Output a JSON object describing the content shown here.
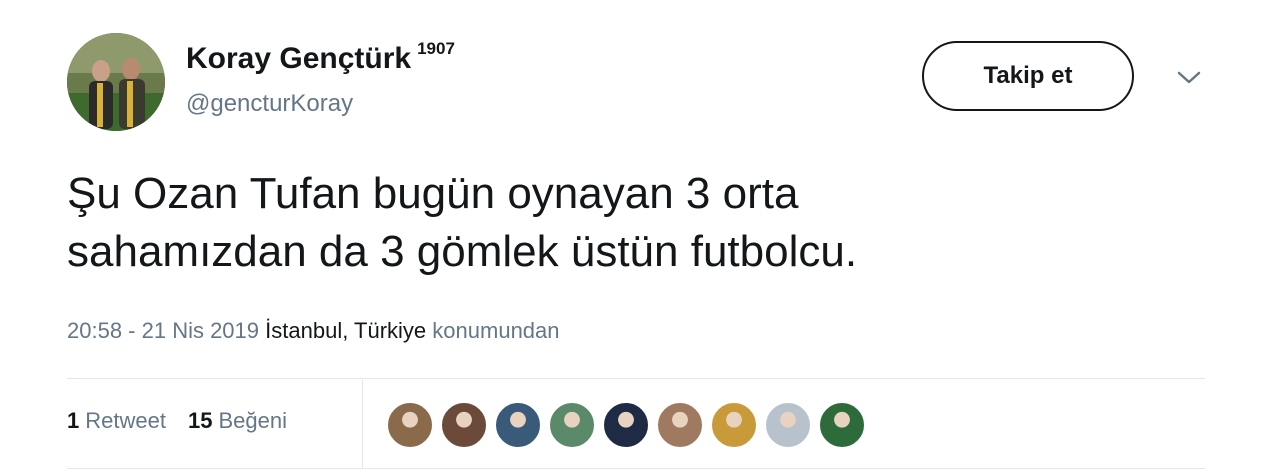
{
  "user": {
    "display_name": "Koray Gençtürk",
    "superscript": "1907",
    "handle": "@gencturKoray"
  },
  "actions": {
    "follow_label": "Takip et",
    "menu_icon": "chevron-down-icon"
  },
  "tweet": {
    "text_line1": "Şu Ozan Tufan bugün oynayan 3 orta",
    "text_line2": "sahamızdan da 3 gömlek üstün futbolcu."
  },
  "meta": {
    "time": "20:58 - 21 Nis 2019",
    "place": "İstanbul, Türkiye",
    "suffix": "konumundan"
  },
  "stats": {
    "retweet_count": "1",
    "retweet_label": "Retweet",
    "like_count": "15",
    "like_label": "Beğeni"
  },
  "colors": {
    "text": "#14171a",
    "secondary": "#657786",
    "divider": "#e1e8ed"
  },
  "likers": [
    {
      "name": "liker-1",
      "color": "#8a6a4a"
    },
    {
      "name": "liker-2",
      "color": "#6b4a3a"
    },
    {
      "name": "liker-3",
      "color": "#3a5a7a"
    },
    {
      "name": "liker-4",
      "color": "#5a8a6a"
    },
    {
      "name": "liker-5",
      "color": "#1f2a44"
    },
    {
      "name": "liker-6",
      "color": "#a07a60"
    },
    {
      "name": "liker-7",
      "color": "#c99a3a"
    },
    {
      "name": "liker-8",
      "color": "#b8c2cc"
    },
    {
      "name": "liker-9",
      "color": "#2e6b3a"
    }
  ]
}
